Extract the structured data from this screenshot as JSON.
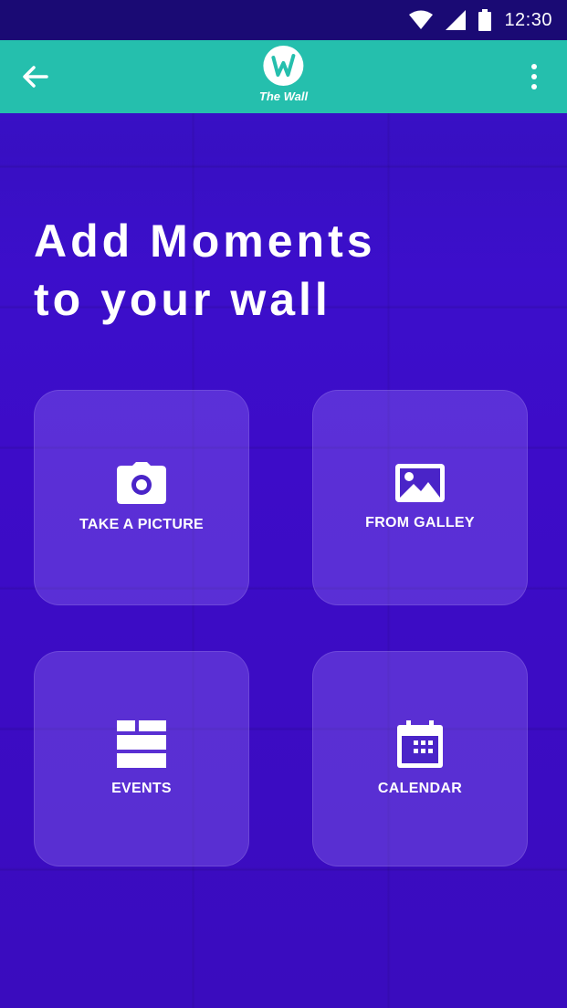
{
  "status_bar": {
    "time": "12:30"
  },
  "app_bar": {
    "logo_text": "The Wall"
  },
  "headline": {
    "line1": "Add Moments",
    "line2": "to your wall"
  },
  "tiles": [
    {
      "label": "TAKE A PICTURE",
      "icon": "camera-icon"
    },
    {
      "label": "FROM GALLEY",
      "icon": "image-icon"
    },
    {
      "label": "EVENTS",
      "icon": "events-icon"
    },
    {
      "label": "CALENDAR",
      "icon": "calendar-icon"
    }
  ],
  "colors": {
    "status_bar": "#1a0a74",
    "app_bar": "#25bfad",
    "background": "#3a0ec4"
  }
}
